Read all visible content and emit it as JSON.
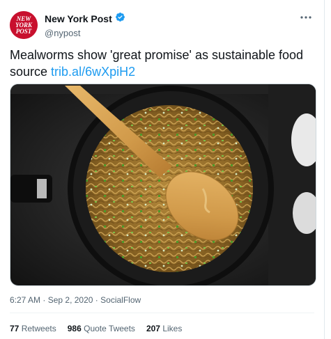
{
  "account": {
    "display_name": "New York Post",
    "handle": "@nypost",
    "avatar_text": [
      "NEW",
      "YORK",
      "POST"
    ],
    "verified_icon": "verified-badge-icon",
    "accent_color": "#c8102e"
  },
  "tweet": {
    "text": "Mealworms show 'great promise' as sustainable food source",
    "link": "trib.al/6wXpiH2"
  },
  "meta": {
    "time": "6:27 AM",
    "date": "Sep 2, 2020",
    "source": "SocialFlow"
  },
  "stats": {
    "retweets_count": "77",
    "retweets_label": "Retweets",
    "quotes_count": "986",
    "quotes_label": "Quote Tweets",
    "likes_count": "207",
    "likes_label": "Likes"
  },
  "colors": {
    "link": "#1d9bf0",
    "verified": "#1d9bf0"
  }
}
